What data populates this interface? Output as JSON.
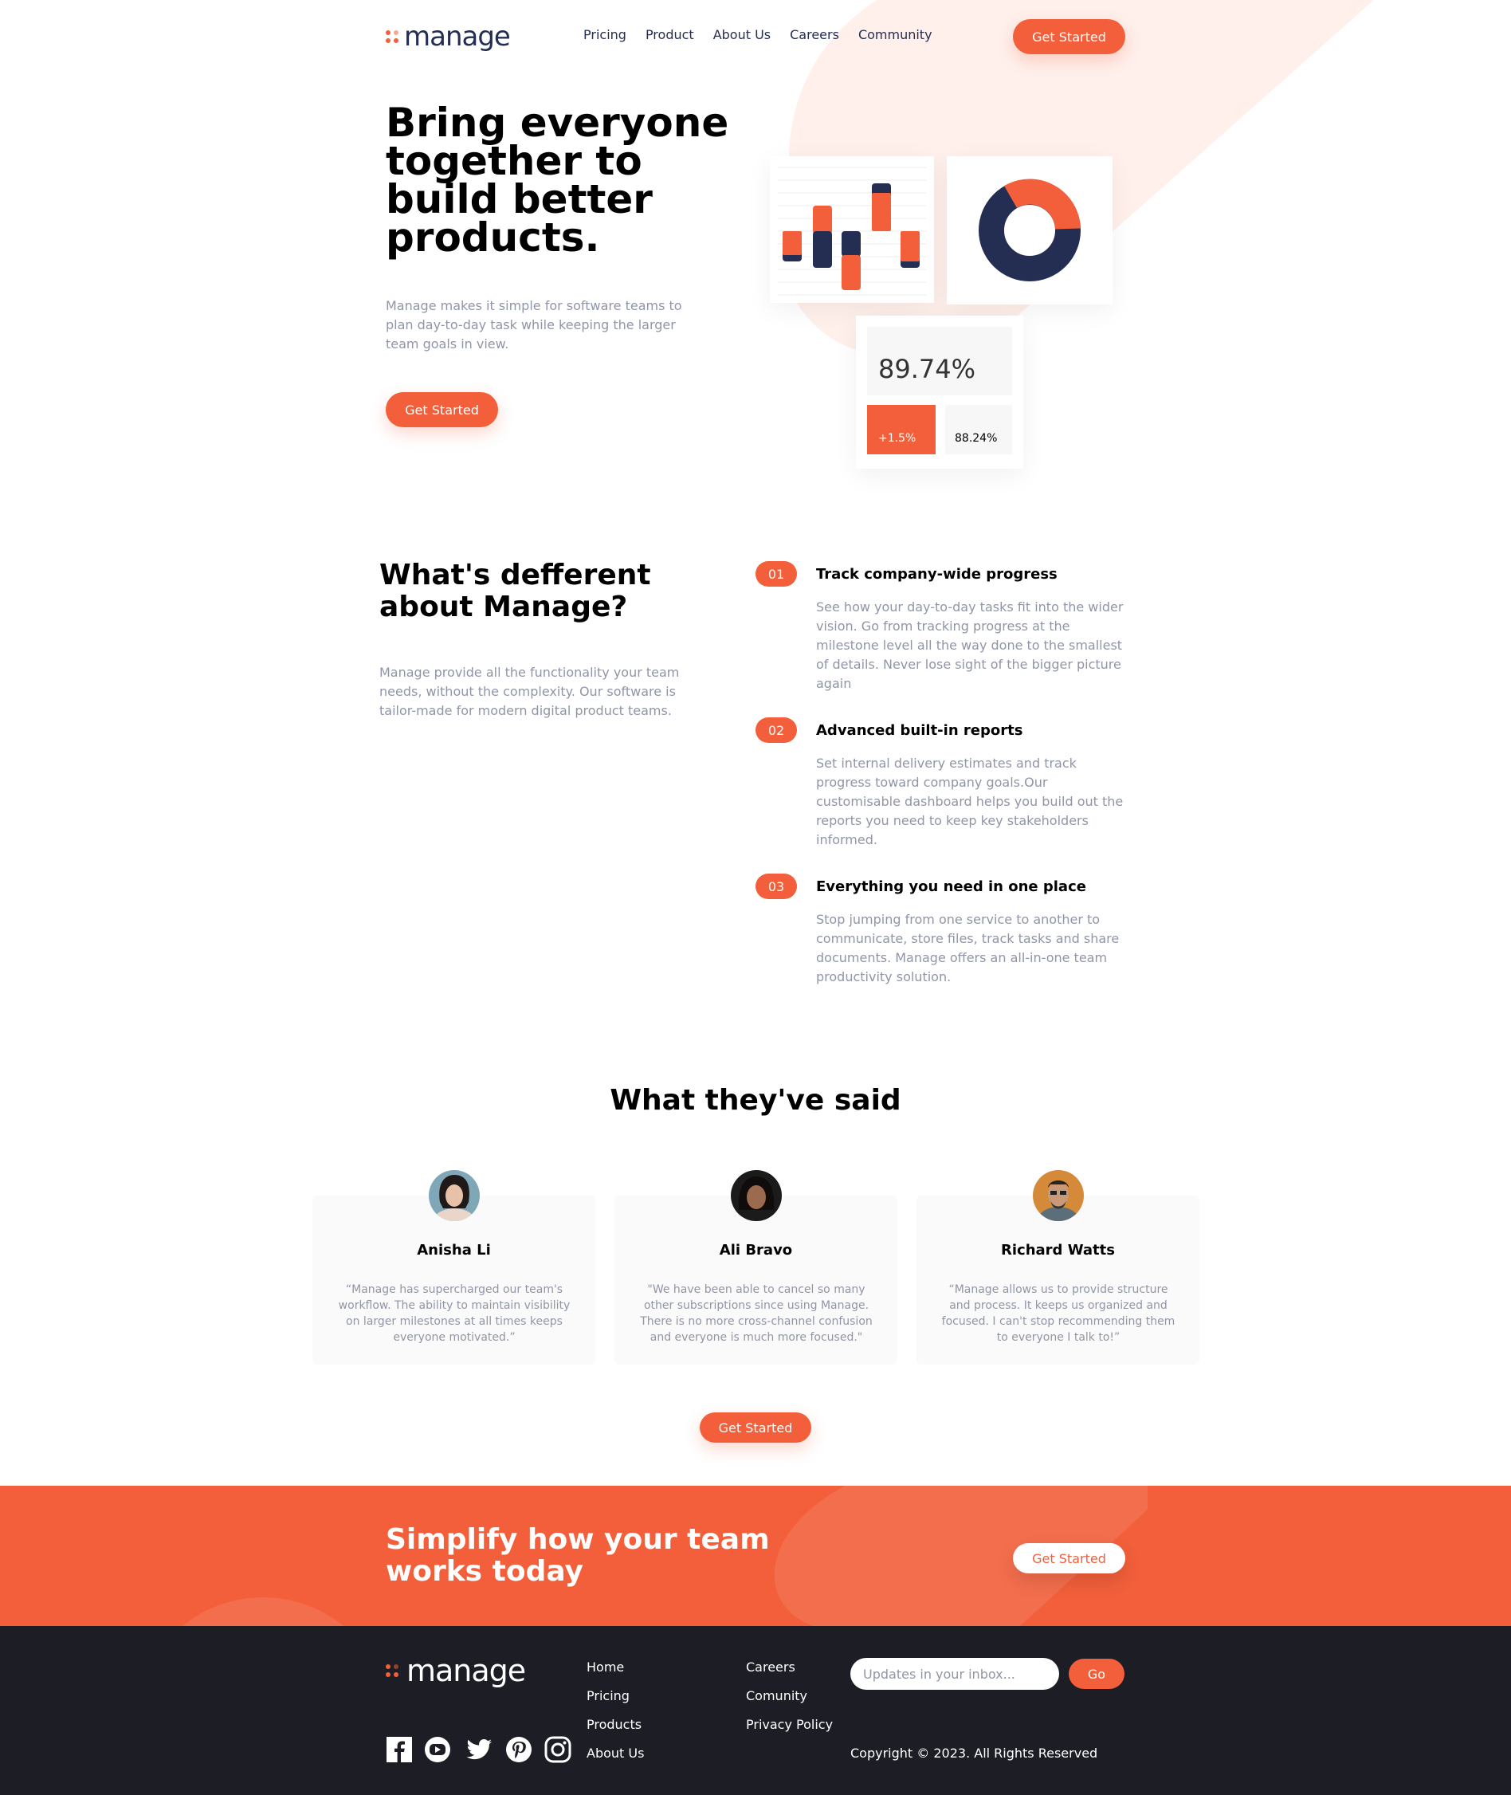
{
  "header": {
    "logo_text": "manage",
    "nav": [
      "Pricing",
      "Product",
      "About Us",
      "Careers",
      "Community"
    ],
    "cta_label": "Get Started"
  },
  "hero": {
    "title": "Bring everyone together to build better products.",
    "description": "Manage makes it simple for software teams to plan day-to-day task while keeping the larger team goals in view.",
    "cta_label": "Get Started",
    "stats": {
      "main_percent": "89.74%",
      "change": "+1.5%",
      "secondary_percent": "88.24%"
    }
  },
  "features_section": {
    "title": "What's defferent about Manage?",
    "description": "Manage provide all the functionality your team needs, without the complexity. Our software is tailor-made for modern digital product teams.",
    "items": [
      {
        "number": "01",
        "title": "Track company-wide progress",
        "text": "See how your day-to-day tasks fit into the wider vision. Go from tracking progress at the milestone level all the way done to the smallest of details. Never lose sight of the bigger picture again"
      },
      {
        "number": "02",
        "title": "Advanced built-in reports",
        "text": "Set internal delivery estimates and track progress toward company goals.Our customisable dashboard helps you build out the reports you need to keep key stakeholders informed."
      },
      {
        "number": "03",
        "title": "Everything you need in one place",
        "text": "Stop jumping from one service to another to communicate, store files, track tasks and share documents. Manage offers an all-in-one team productivity solution."
      }
    ]
  },
  "testimonials": {
    "title": "What they've said",
    "items": [
      {
        "name": "Anisha Li",
        "quote": "“Manage has supercharged our team's workflow. The ability to maintain visibility on larger milestones at all times keeps everyone motivated.”"
      },
      {
        "name": "Ali Bravo",
        "quote": "\"We have been able to cancel so many other subscriptions since using Manage. There is no more cross-channel confusion and everyone is much more focused.\""
      },
      {
        "name": "Richard Watts",
        "quote": "“Manage allows us to provide structure and process. It keeps us organized and focused. I can't stop recommending them to everyone I talk to!”"
      }
    ],
    "cta_label": "Get Started"
  },
  "cta_banner": {
    "title": "Simplify how your team works today",
    "button_label": "Get Started"
  },
  "footer": {
    "logo_text": "manage",
    "links_col1": [
      "Home",
      "Pricing",
      "Products",
      "About Us"
    ],
    "links_col2": [
      "Careers",
      "Comunity",
      "Privacy Policy"
    ],
    "newsletter_placeholder": "Updates in your inbox...",
    "go_label": "Go",
    "copyright": "Copyright © 2023. All Rights Reserved",
    "social_icons": [
      "facebook-icon",
      "youtube-icon",
      "twitter-icon",
      "pinterest-icon",
      "instagram-icon"
    ]
  },
  "colors": {
    "accent": "#f25f3a",
    "navy": "#242d52",
    "footer_bg": "#1d1e25",
    "muted_text": "#9095a7",
    "light_tint": "#fff0ec"
  }
}
